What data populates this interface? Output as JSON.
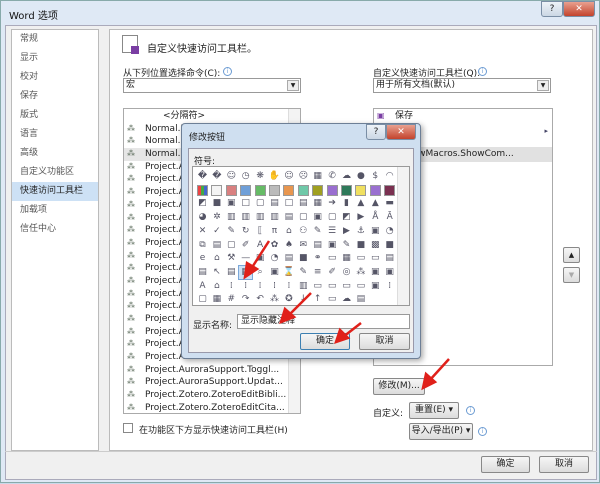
{
  "window": {
    "title": "Word 选项",
    "help": "?",
    "close": "✕"
  },
  "sidebar": {
    "items": [
      {
        "label": "常规"
      },
      {
        "label": "显示"
      },
      {
        "label": "校对"
      },
      {
        "label": "保存"
      },
      {
        "label": "版式"
      },
      {
        "label": "语言"
      },
      {
        "label": "高级"
      },
      {
        "label": "自定义功能区"
      },
      {
        "label": "快速访问工具栏"
      },
      {
        "label": "加载项"
      },
      {
        "label": "信任中心"
      }
    ],
    "selected": 8
  },
  "main": {
    "heading": "自定义快速访问工具栏。",
    "choose_label": "从下列位置选择命令(C):",
    "choose_value": "宏",
    "commands": [
      "<分隔符>",
      "Normal.N",
      "Normal.N",
      "Normal.N",
      "Project.Au",
      "Project.Au",
      "Project.Au",
      "Project.Au",
      "Project.Au",
      "Project.Au",
      "Project.Au",
      "Project.Au",
      "Project.Au",
      "Project.Au",
      "Project.Au",
      "Project.Au",
      "Project.Au",
      "Project.Au",
      "Project.Au",
      "Project.Au",
      "Project.AuroraSupport.Toggl...",
      "Project.AuroraSupport.Updat...",
      "Project.Zotero.ZoteroEditBibli...",
      "Project.Zotero.ZoteroEditCita..."
    ],
    "customize_label": "自定义快速访问工具栏(Q):",
    "customize_value": "用于所有文档(默认)",
    "toolbar_items": [
      "保存",
      "",
      "al.NewMacros.ShowCom..."
    ],
    "modify_button": "修改(M)...",
    "custom_label": "自定义:",
    "reset_button": "重置(E) ▾",
    "import_export_button": "导入/导出(P) ▾",
    "show_below_checkbox": "在功能区下方显示快速访问工具栏(H)",
    "ok": "确定",
    "cancel": "取消"
  },
  "dialog": {
    "title": "修改按钮",
    "symbols_label": "符号:",
    "display_name_label": "显示名称:",
    "display_name_value": "显示隐藏注释",
    "ok": "确定",
    "cancel": "取消",
    "help": "?",
    "close": "✕"
  },
  "colors": {
    "selection": "#cde1f5",
    "arrow": "#e0201a"
  }
}
